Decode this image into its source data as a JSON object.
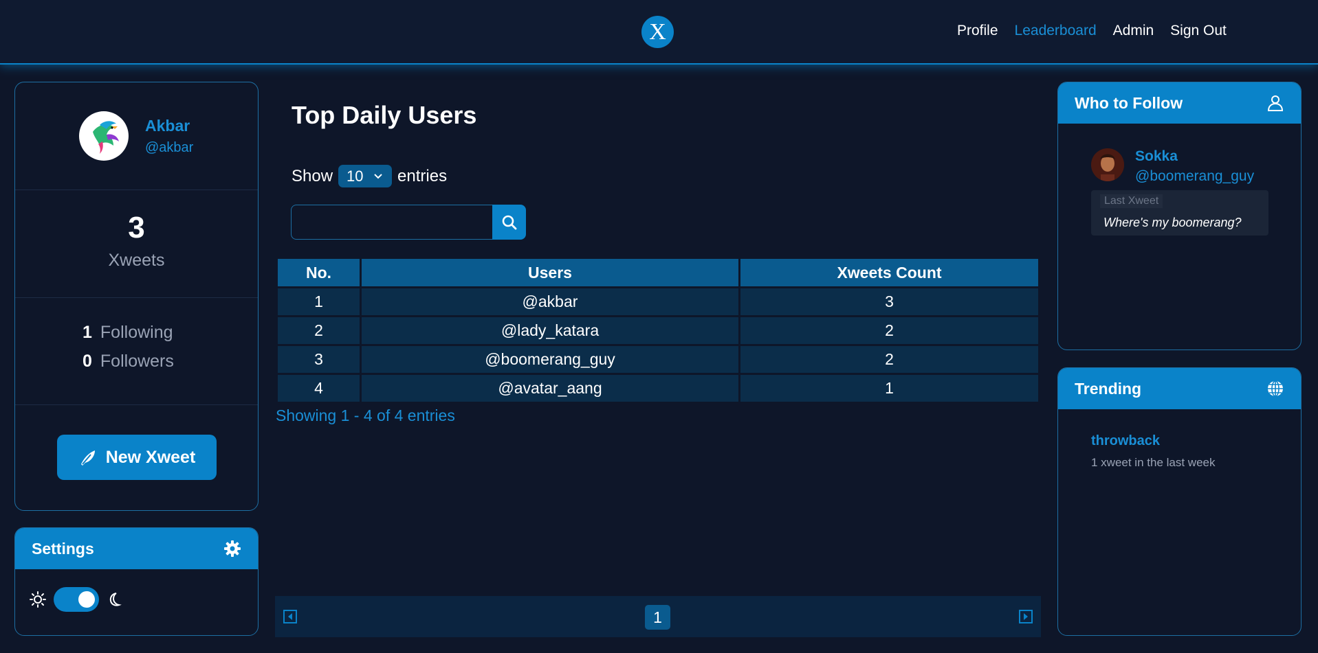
{
  "header": {
    "logo_text": "X",
    "nav": [
      {
        "label": "Profile",
        "active": false
      },
      {
        "label": "Leaderboard",
        "active": true
      },
      {
        "label": "Admin",
        "active": false
      },
      {
        "label": "Sign Out",
        "active": false
      }
    ]
  },
  "profile": {
    "name": "Akbar",
    "handle": "@akbar",
    "xweets_count": "3",
    "xweets_label": "Xweets",
    "following_count": "1",
    "following_label": "Following",
    "followers_count": "0",
    "followers_label": "Followers",
    "new_xweet_label": "New Xweet",
    "avatar_icon": "bird-avatar-icon"
  },
  "settings": {
    "title": "Settings",
    "theme_dark": true
  },
  "main": {
    "title": "Top Daily Users",
    "show_label": "Show",
    "entries_value": "10",
    "entries_label": "entries",
    "search_placeholder": "",
    "columns": [
      "No.",
      "Users",
      "Xweets Count"
    ],
    "rows": [
      [
        "1",
        "@akbar",
        "3"
      ],
      [
        "2",
        "@lady_katara",
        "2"
      ],
      [
        "3",
        "@boomerang_guy",
        "2"
      ],
      [
        "4",
        "@avatar_aang",
        "1"
      ]
    ],
    "showing_text": "Showing 1 - 4 of 4 entries",
    "current_page": "1"
  },
  "who_to_follow": {
    "title": "Who to Follow",
    "user": {
      "name": "Sokka",
      "handle": "@boomerang_guy",
      "last_label": "Last Xweet",
      "last_text": "Where's my boomerang?"
    }
  },
  "trending": {
    "title": "Trending",
    "tag": "throwback",
    "subtitle": "1 xweet in the last week"
  },
  "colors": {
    "accent": "#0a83c9",
    "background": "#0e1629",
    "link": "#1a8fd6"
  }
}
